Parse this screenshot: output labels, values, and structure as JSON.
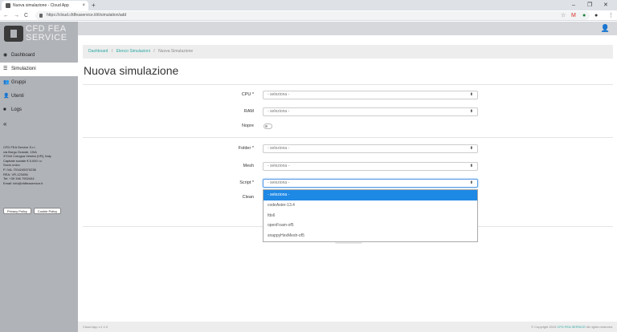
{
  "browser": {
    "tab_title": "Nuova simulazione - Cloud App",
    "tab_close": "×",
    "new_tab": "+",
    "url": "https://cloud.cfdfeaservice.it/it/simulation/add",
    "window_controls": [
      "–",
      "❐",
      "✕"
    ]
  },
  "sidebar": {
    "logo_line1": "CFD FEA",
    "logo_line2": "SERVICE",
    "items": [
      {
        "label": "Dashboard",
        "icon": "dashboard-icon",
        "glyph": "◉"
      },
      {
        "label": "Simulazioni",
        "icon": "list-icon",
        "glyph": "☰"
      },
      {
        "label": "Gruppi",
        "icon": "group-icon",
        "glyph": "👥"
      },
      {
        "label": "Utenti",
        "icon": "user-icon",
        "glyph": "👤"
      },
      {
        "label": "Logs",
        "icon": "logs-icon",
        "glyph": "■"
      },
      {
        "label": "«",
        "icon": "collapse-icon",
        "glyph": ""
      }
    ],
    "company": [
      "CFD FEA Service S.r.l.",
      "via Borgo Grande, 19/A",
      "37044 Cologna Veneta (VR), Italy",
      "Capitale sociale € 5.000 i.v.",
      "Socio unico",
      "P. IVA: IT04245370238",
      "REA: VR-123456",
      "Tel: +39 346 7902444",
      "Email: info@cfdfeaservice.it"
    ],
    "privacy_label": "Privacy Policy",
    "cookie_label": "Cookie Policy"
  },
  "breadcrumb": {
    "dashboard": "Dashboard",
    "elenco": "Elenco Simulazioni",
    "current": "Nuova Simulazione",
    "separator": "/"
  },
  "page_title": "Nuova simulazione",
  "form": {
    "cpu_label": "CPU *",
    "cpu_value": "- seleziona -",
    "ram_label": "RAM",
    "ram_value": "- seleziona -",
    "nopre_label": "Nopre",
    "folder_label": "Folder *",
    "folder_value": "- seleziona -",
    "mesh_label": "Mesh",
    "mesh_value": "- seleziona -",
    "script_label": "Script *",
    "script_value": "- seleziona -",
    "clean_label": "Clean",
    "arrow": "⬍"
  },
  "script_options": [
    "- seleziona -",
    "codeAster-13.4",
    "fds6",
    "openFoam-of5",
    "snappyHexMesh-of5"
  ],
  "footer": {
    "version": "Cloud App v.1.1.0",
    "copyright_prefix": "© Copyright 2019",
    "brand": "CFD FEA SERVICE",
    "copyright_suffix": "All rights reserved."
  }
}
